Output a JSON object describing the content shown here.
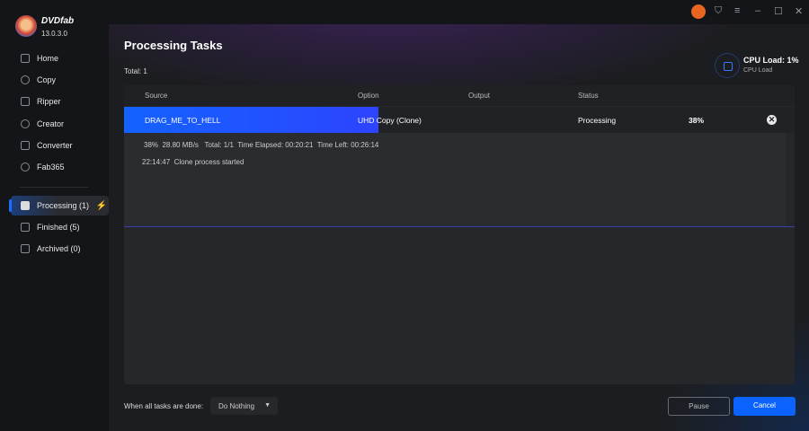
{
  "app": {
    "name": "DVDfab",
    "version": "13.0.3.0"
  },
  "sidebar": {
    "items": [
      {
        "label": "Home"
      },
      {
        "label": "Copy"
      },
      {
        "label": "Ripper"
      },
      {
        "label": "Creator"
      },
      {
        "label": "Converter"
      },
      {
        "label": "Fab365"
      }
    ],
    "tasks": [
      {
        "label": "Processing (1)"
      },
      {
        "label": "Finished (5)"
      },
      {
        "label": "Archived (0)"
      }
    ]
  },
  "page": {
    "title": "Processing Tasks",
    "total": "Total: 1"
  },
  "cpu": {
    "load": "CPU Load: 1%",
    "label": "CPU Load"
  },
  "table": {
    "headers": [
      "Source",
      "Option",
      "Output",
      "Status"
    ],
    "task": {
      "source": "DRAG_ME_TO_HELL",
      "option": "UHD Copy (Clone)",
      "output": "",
      "status": "Processing",
      "percent": "38%",
      "progress": 38,
      "detail_line": "38%  28.80 MB/s   Total: 1/1  Time Elapsed: 00:20:21  Time Left: 00:26:14",
      "log_line": "22:14:47  Clone process started"
    }
  },
  "footer": {
    "label": "When all tasks are done:",
    "select": "Do Nothing",
    "pause": "Pause",
    "cancel": "Cancel"
  },
  "colors": {
    "accent": "#0a62ff"
  }
}
